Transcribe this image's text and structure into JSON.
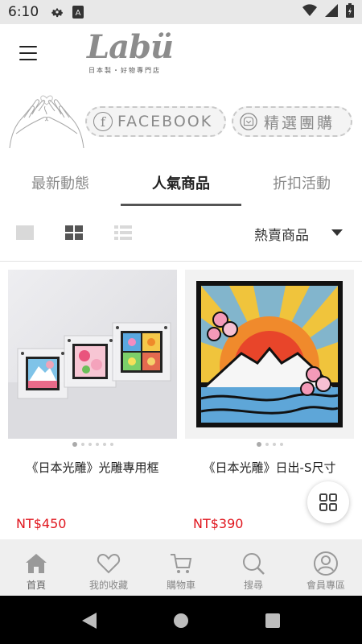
{
  "status_bar": {
    "time": "6:10",
    "icons": [
      "gear-icon",
      "a-box-icon",
      "wifi-icon",
      "signal-icon",
      "battery-icon"
    ]
  },
  "header": {
    "logo_word": "Labü",
    "logo_tagline": "日本製・好物專門店",
    "menu_icon": "hamburger-icon"
  },
  "banner": {
    "facebook_label": "FACEBOOK",
    "group_buy_label": "精選團購"
  },
  "tabs": [
    {
      "label": "最新動態",
      "active": false
    },
    {
      "label": "人氣商品",
      "active": true
    },
    {
      "label": "折扣活動",
      "active": false
    }
  ],
  "toolbar": {
    "view_modes": [
      "single-view-icon",
      "grid-view-icon",
      "list-view-icon"
    ],
    "active_view": "grid-view-icon",
    "sort_selected": "熱賣商品"
  },
  "products": [
    {
      "name": "《日本光雕》光雕專用框",
      "price": "NT$450",
      "image_dots": 6,
      "active_dot": 0
    },
    {
      "name": "《日本光雕》日出-S尺寸",
      "price": "NT$390",
      "image_dots": 4,
      "active_dot": 0
    }
  ],
  "bottom_nav": [
    {
      "label": "首頁",
      "icon": "home-icon",
      "active": true
    },
    {
      "label": "我的收藏",
      "icon": "heart-icon",
      "active": false
    },
    {
      "label": "購物車",
      "icon": "cart-icon",
      "active": false
    },
    {
      "label": "搜尋",
      "icon": "search-icon",
      "active": false
    },
    {
      "label": "會員專區",
      "icon": "user-icon",
      "active": false
    }
  ],
  "colors": {
    "price": "#e0161e",
    "logo": "#8c8c8c",
    "nav_bg": "#efefef"
  }
}
